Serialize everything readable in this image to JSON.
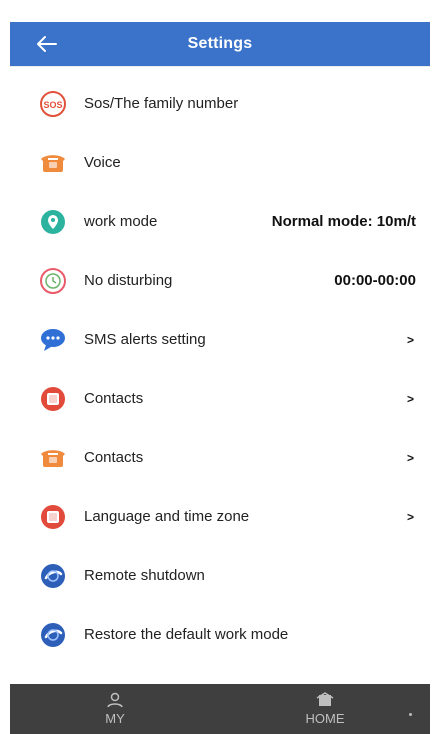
{
  "header": {
    "title": "Settings",
    "back_icon": "back-arrow-icon"
  },
  "items": [
    {
      "label": "Sos/The family number",
      "icon": "sos-icon"
    },
    {
      "label": "Voice",
      "icon": "phone-icon"
    },
    {
      "label": "work mode",
      "icon": "location-pin-icon",
      "value": "Normal mode: 10m/t"
    },
    {
      "label": "No disturbing",
      "icon": "do-not-disturb-icon",
      "value": "00:00-00:00"
    },
    {
      "label": "SMS alerts setting",
      "icon": "chat-bubble-icon",
      "chevron": ">"
    },
    {
      "label": "Contacts",
      "icon": "contacts-book-icon",
      "chevron": ">"
    },
    {
      "label": "Contacts",
      "icon": "phone-icon",
      "chevron": ">"
    },
    {
      "label": "Language and time zone",
      "icon": "contacts-book-icon",
      "chevron": ">"
    },
    {
      "label": "Remote shutdown",
      "icon": "power-globe-icon"
    },
    {
      "label": "Restore the default work mode",
      "icon": "power-globe-icon"
    }
  ],
  "tabbar": {
    "tabs": [
      {
        "label": "MY",
        "icon": "person-icon"
      },
      {
        "label": "HOME",
        "icon": "home-icon"
      }
    ]
  },
  "colors": {
    "header": "#3a73c9",
    "tabbar": "#3f3f3f",
    "sos_red": "#e0533a",
    "phone_orange": "#f08a3c",
    "pin_green": "#2bb3a0",
    "chat_blue": "#2f6fd6",
    "book_red": "#e24a3b",
    "globe_blue": "#2d5fb8"
  }
}
